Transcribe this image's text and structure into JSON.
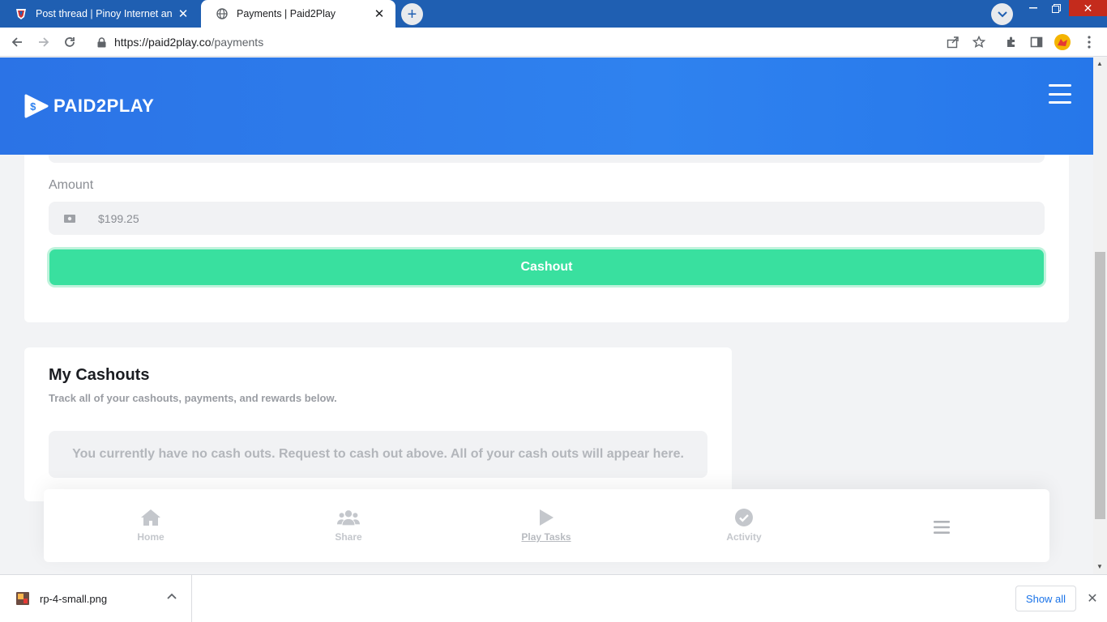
{
  "browser": {
    "tabs": [
      {
        "title": "Post thread | Pinoy Internet and Te",
        "active": false
      },
      {
        "title": "Payments | Paid2Play",
        "active": true
      }
    ],
    "url_host": "https://paid2play.co",
    "url_path": "/payments"
  },
  "header": {
    "logo_text": "PAID2PLAY"
  },
  "payout_form": {
    "amount_label": "Amount",
    "amount_value": "$199.25",
    "cashout_label": "Cashout"
  },
  "my_cashouts": {
    "title": "My Cashouts",
    "subtitle": "Track all of your cashouts, payments, and rewards below.",
    "empty_message": "You currently have no cash outs. Request to cash out above. All of your cash outs will appear here."
  },
  "bottom_nav": {
    "items": [
      {
        "label": "Home",
        "icon": "home-icon"
      },
      {
        "label": "Share",
        "icon": "users-icon"
      },
      {
        "label": "Play Tasks",
        "icon": "play-icon"
      },
      {
        "label": "Activity",
        "icon": "check-circle-icon"
      },
      {
        "label": "",
        "icon": "menu-icon"
      }
    ]
  },
  "download_bar": {
    "file_name": "rp-4-small.png",
    "show_all_label": "Show all"
  },
  "colors": {
    "header_blue": "#2f82ef",
    "cashout_green": "#39e09f",
    "tabstrip_blue": "#1f5fb2"
  }
}
